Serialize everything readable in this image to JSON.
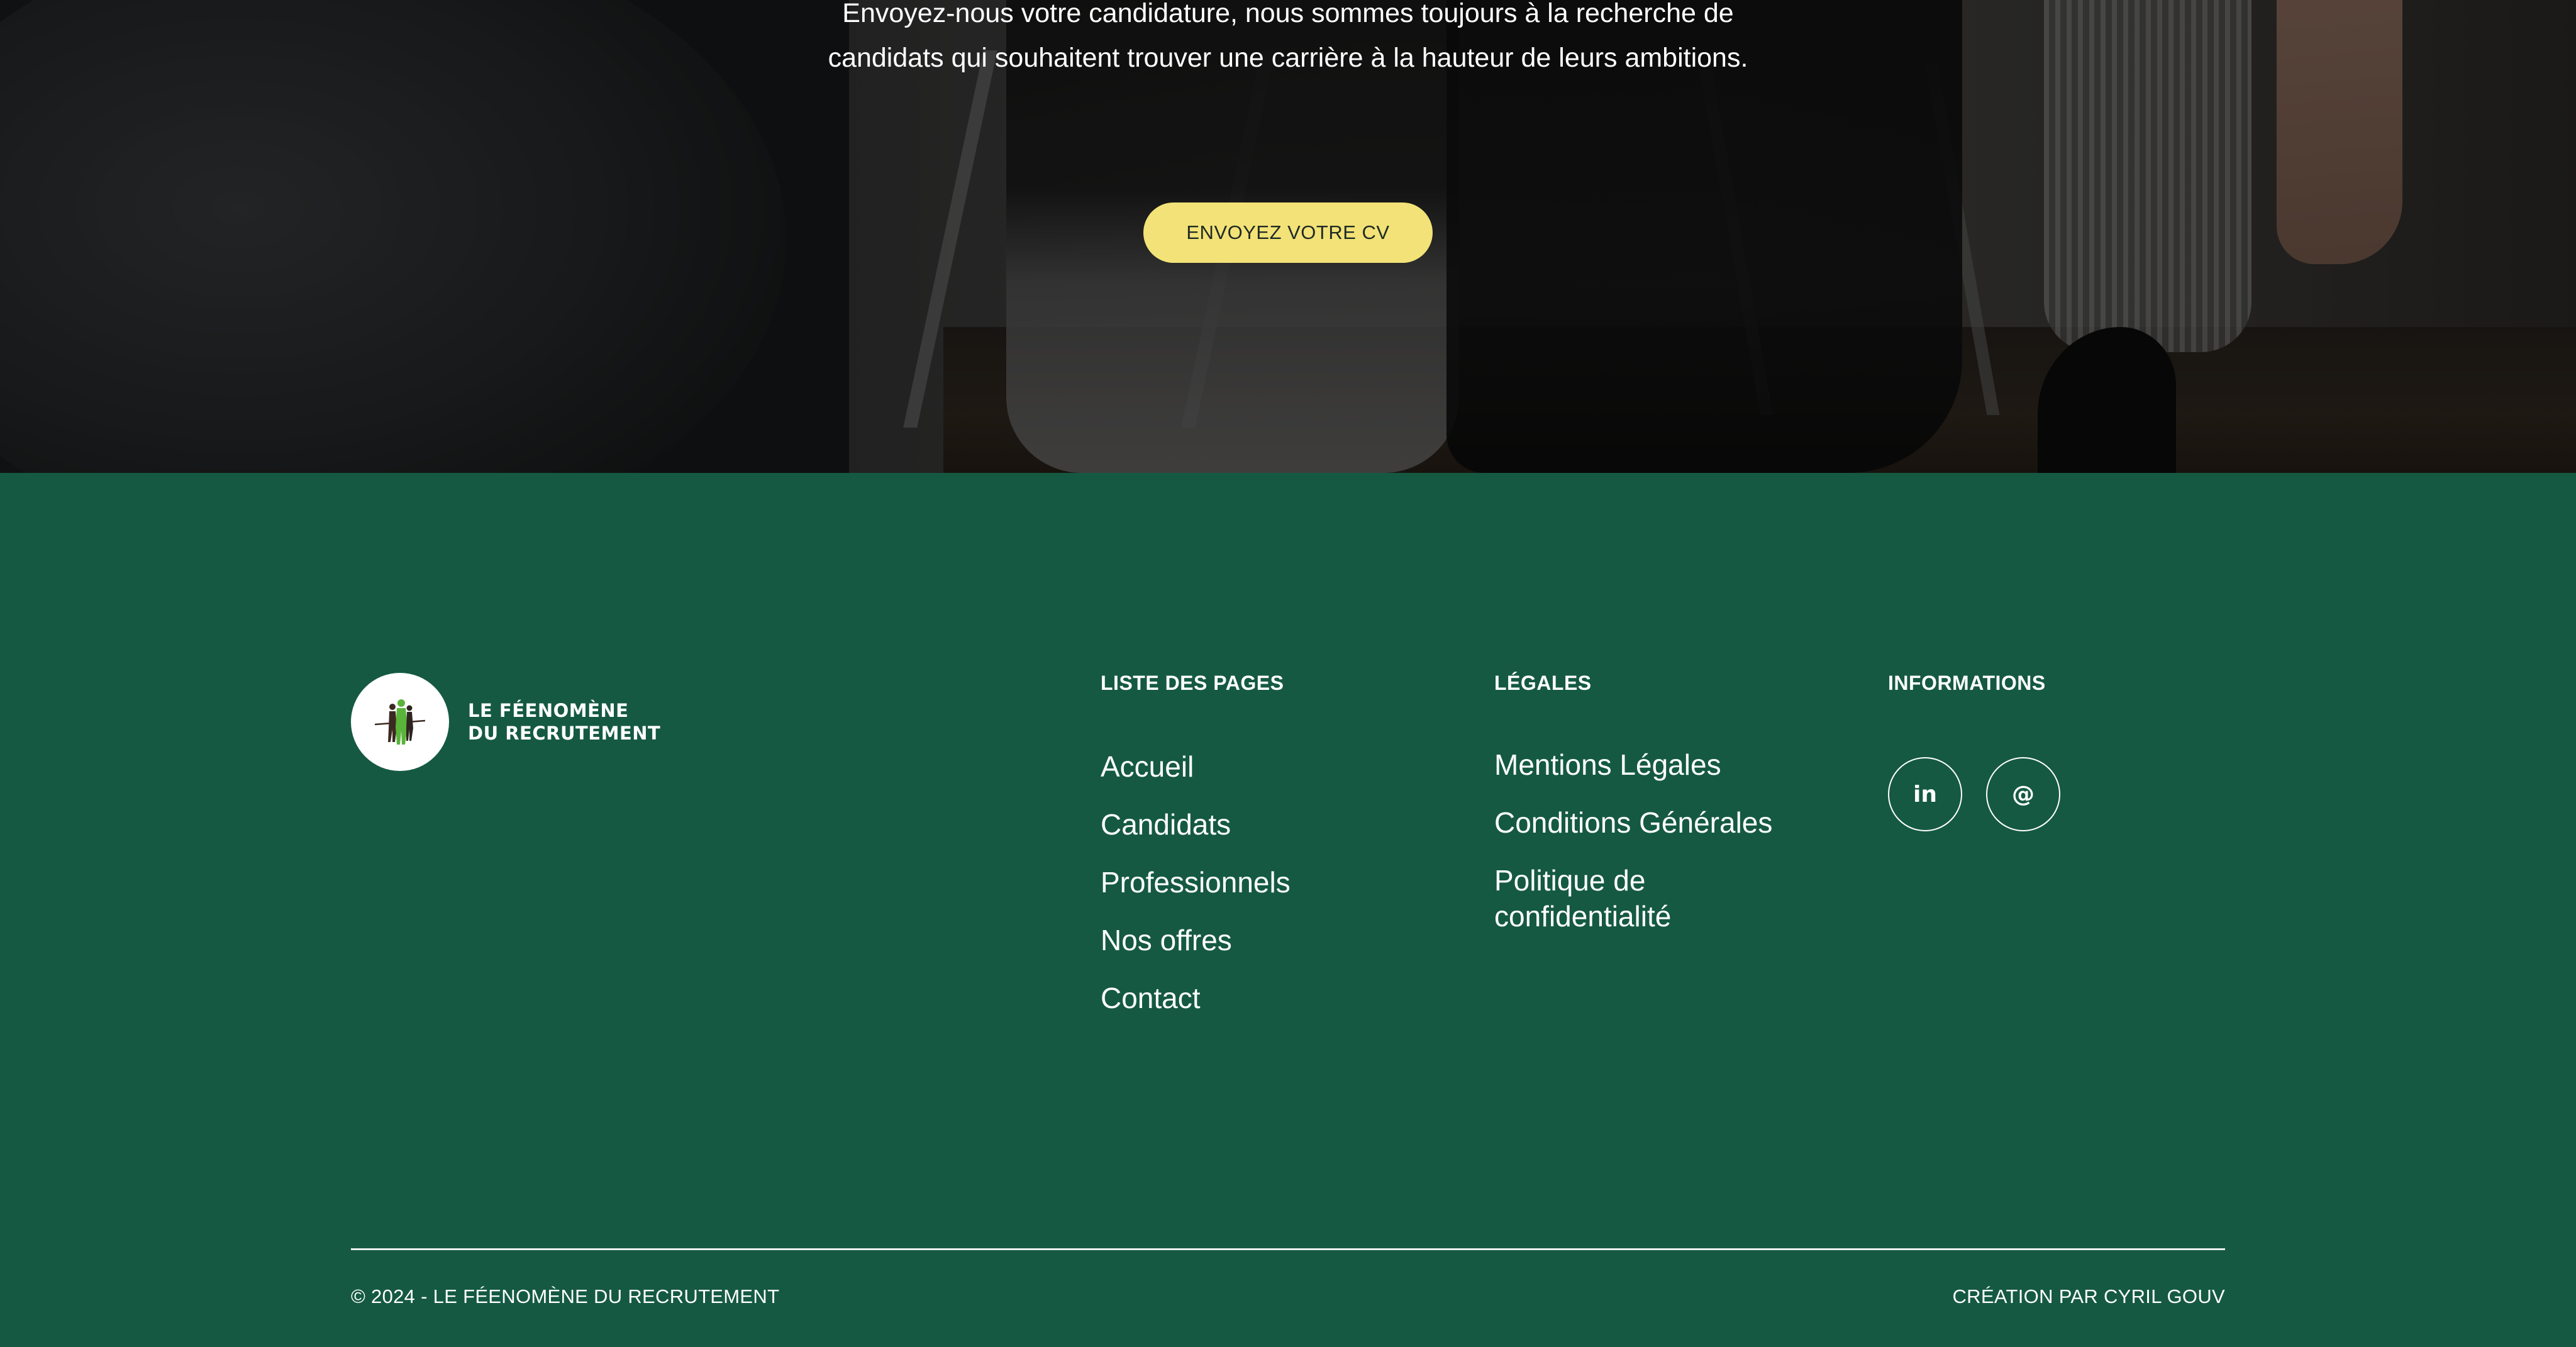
{
  "hero": {
    "text": "Envoyez-nous votre candidature, nous sommes toujours à la recherche de candidats qui souhaitent trouver une carrière à la hauteur de leurs ambitions.",
    "button_label": "ENVOYEZ VOTRE CV"
  },
  "footer": {
    "logo": {
      "line1": "LE FÉENOMÈNE",
      "line2": "DU RECRUTEMENT"
    },
    "pages": {
      "title": "LISTE DES PAGES",
      "items": [
        "Accueil",
        "Candidats",
        "Professionnels",
        "Nos offres",
        "Contact"
      ]
    },
    "legal": {
      "title": "LÉGALES",
      "items": [
        "Mentions Légales",
        "Conditions Générales",
        "Politique de confidentialité"
      ]
    },
    "info": {
      "title": "INFORMATIONS",
      "social": [
        {
          "icon": "linkedin-icon",
          "glyph": "in"
        },
        {
          "icon": "email-icon",
          "glyph": "@"
        }
      ]
    },
    "copyright": "© 2024 - LE FÉENOMÈNE DU RECRUTEMENT",
    "credit": "CRÉATION PAR CYRIL GOUV"
  },
  "colors": {
    "footer_bg": "#155943",
    "button_bg": "#f3e277",
    "text": "#ffffff"
  }
}
